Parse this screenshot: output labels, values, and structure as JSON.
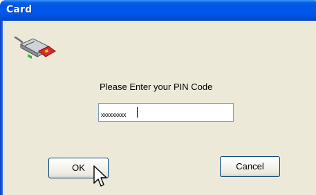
{
  "window": {
    "title": "Card"
  },
  "dialog": {
    "prompt": "Please Enter your PIN Code",
    "pin_value": "xxxxxxxxx"
  },
  "buttons": {
    "ok_label": "OK",
    "cancel_label": "Cancel"
  },
  "icons": {
    "card_reader": "card-reader-icon",
    "cursor": "mouse-pointer"
  },
  "colors": {
    "titlebar": "#0055e5",
    "client_background": "#ece9d8",
    "button_border": "#003c74"
  }
}
